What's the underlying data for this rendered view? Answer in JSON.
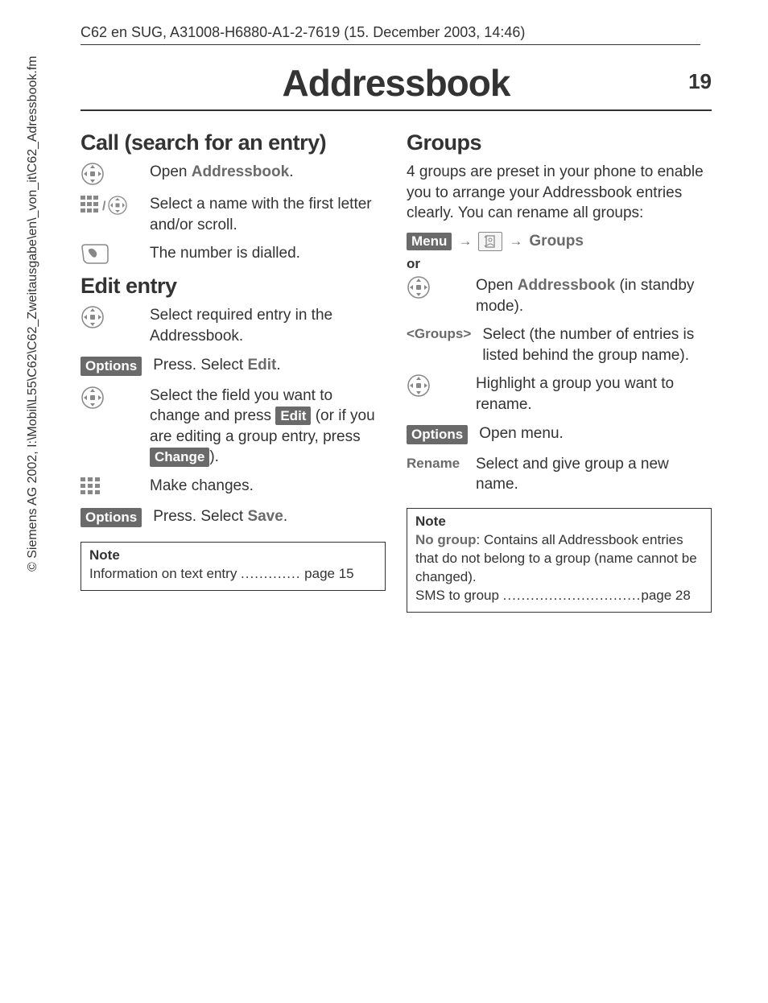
{
  "header": {
    "line": "C62 en SUG, A31008-H6880-A1-2-7619 (15. December 2003, 14:46)"
  },
  "title": {
    "main": "Addressbook",
    "page": "19"
  },
  "sidebar": {
    "text": "© Siemens AG 2002, I:\\Mobil\\L55\\C62\\C62_Zweitausgabe\\en\\_von_it\\C62_Adressbook.fm"
  },
  "left": {
    "h_call": "Call (search for an entry)",
    "call_steps": {
      "open_pre": "Open ",
      "open_b": "Addressbook",
      "open_post": ".",
      "select": "Select a name with the first letter and/or scroll.",
      "dial": "The number is dialled."
    },
    "h_edit": "Edit entry",
    "edit_steps": {
      "select_entry": "Select required entry in the Addressbook.",
      "options_key": "Options",
      "press_select_pre": "Press. Select ",
      "press_select_b": "Edit",
      "press_select_post": ".",
      "field_pre": "Select the field you want to change and press ",
      "field_key": "Edit",
      "field_mid": " (or if you are editing a group entry, press ",
      "field_key2": "Change",
      "field_post": ").",
      "make_changes": "Make changes.",
      "save_pre": "Press. Select ",
      "save_b": "Save",
      "save_post": "."
    },
    "note": {
      "title": "Note",
      "line_label": "Information on text entry ",
      "line_dots": ".............",
      "line_page": " page 15"
    }
  },
  "right": {
    "h_groups": "Groups",
    "intro": "4 groups are preset in your phone to enable you to arrange your Addressbook entries clearly. You can rename all groups:",
    "path": {
      "menu": "Menu",
      "groups": "Groups"
    },
    "or": "or",
    "steps": {
      "open_pre": "Open ",
      "open_b": "Addressbook",
      "open_post": " (in standby mode).",
      "groups_key": "<Groups>",
      "groups_text": "Select (the number of entries is listed behind the group name).",
      "highlight": "Highlight a group you want to rename.",
      "options_key": "Options",
      "open_menu": "Open menu.",
      "rename_key": "Rename",
      "rename_text": "Select and give group a new name."
    },
    "note": {
      "title": "Note",
      "nogroup_label": "No group",
      "nogroup_text": ":  Contains all Addressbook entries that do not belong to a group (name cannot be changed).",
      "sms_label": "SMS to group ",
      "sms_dots": "..............................",
      "sms_page": "page 28"
    }
  }
}
